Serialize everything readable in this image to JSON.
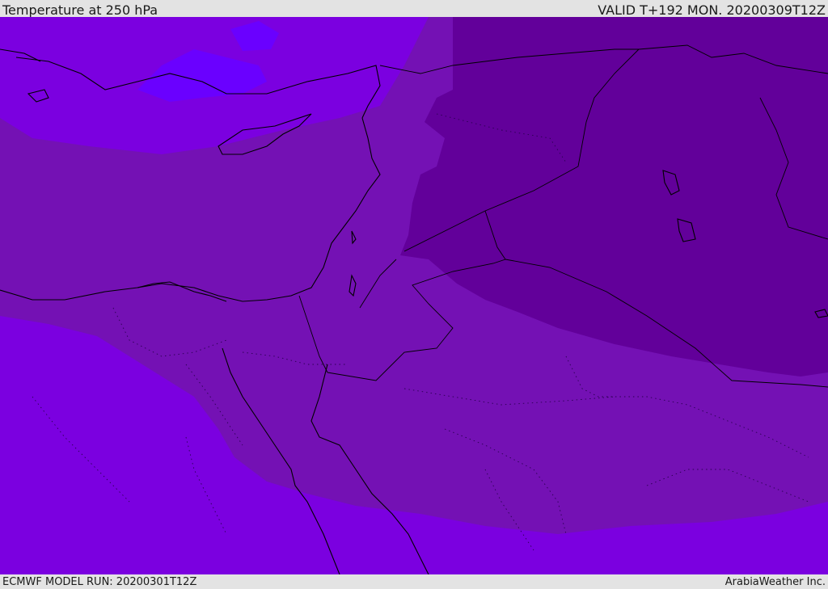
{
  "header": {
    "title": "Temperature at 250 hPa",
    "valid_time": "VALID T+192 MON. 20200309T12Z"
  },
  "footer": {
    "model_run": "ECMWF MODEL RUN: 20200301T12Z",
    "credit": "ArabiaWeather Inc."
  },
  "map": {
    "region": "Eastern Mediterranean / Levant",
    "colors": {
      "warmest_band": "#7b00e0",
      "warm_band": "#7411b4",
      "cold_band": "#62009a",
      "coldest_band": "#6a00c8",
      "sea_highlight": "#6a00ff",
      "coastline": "#000000"
    }
  }
}
